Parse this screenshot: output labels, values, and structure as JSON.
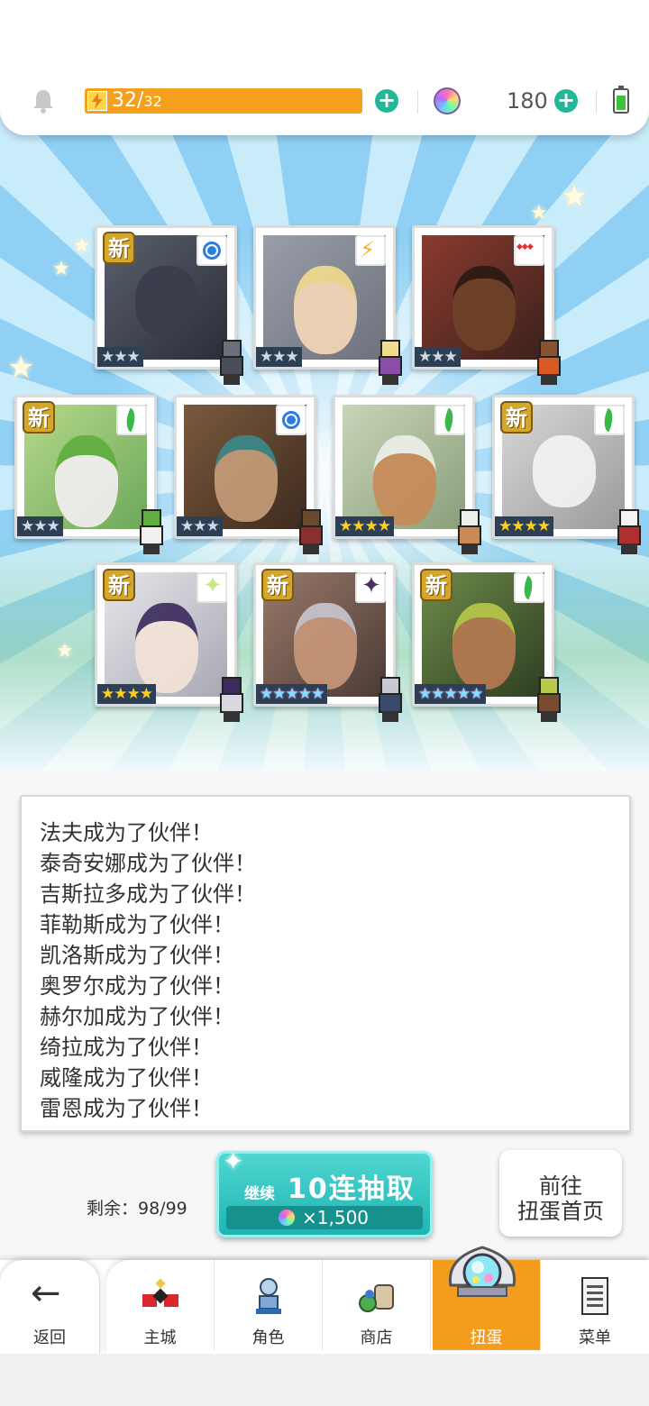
{
  "status_bar": {
    "stamina_current": "32/",
    "stamina_max": "32",
    "gems": "180",
    "colors": {
      "stamina": "#f4a01e",
      "plus": "#21b89a"
    }
  },
  "cards": [
    {
      "new_label": "新",
      "element": "water",
      "rarity": "★★★",
      "rarity_level": 3
    },
    {
      "new_label": "",
      "element": "thunder",
      "rarity": "★★★",
      "rarity_level": 3
    },
    {
      "new_label": "",
      "element": "fire",
      "rarity": "★★★",
      "rarity_level": 3
    },
    {
      "new_label": "新",
      "element": "wind",
      "rarity": "★★★",
      "rarity_level": 3
    },
    {
      "new_label": "",
      "element": "water",
      "rarity": "★★★",
      "rarity_level": 3
    },
    {
      "new_label": "",
      "element": "wind",
      "rarity": "★★★★",
      "rarity_level": 4
    },
    {
      "new_label": "新",
      "element": "wind",
      "rarity": "★★★★",
      "rarity_level": 4
    },
    {
      "new_label": "新",
      "element": "light",
      "rarity": "★★★★",
      "rarity_level": 4
    },
    {
      "new_label": "新",
      "element": "dark",
      "rarity": "★★★★★",
      "rarity_level": 5
    },
    {
      "new_label": "新",
      "element": "wind",
      "rarity": "★★★★★",
      "rarity_level": 5
    }
  ],
  "log": {
    "lines": [
      "法夫成为了伙伴！",
      "泰奇安娜成为了伙伴！",
      "吉斯拉多成为了伙伴！",
      "菲勒斯成为了伙伴！",
      "凯洛斯成为了伙伴！",
      "奥罗尔成为了伙伴！",
      "赫尔加成为了伙伴！",
      "绮拉成为了伙伴！",
      "威隆成为了伙伴！",
      "雷恩成为了伙伴！"
    ]
  },
  "draw": {
    "remaining_label": "剩余：98/99",
    "continue_label": "继续",
    "title": "10连抽取",
    "cost": "×1,500"
  },
  "gacha_home": {
    "line1": "前往",
    "line2": "扭蛋首页"
  },
  "nav": {
    "back": "返回",
    "tabs": [
      {
        "label": "主城",
        "icon": "castle-icon"
      },
      {
        "label": "角色",
        "icon": "character-icon"
      },
      {
        "label": "商店",
        "icon": "shop-icon"
      },
      {
        "label": "扭蛋",
        "icon": "gacha-icon",
        "active": true
      },
      {
        "label": "菜单",
        "icon": "menu-icon"
      }
    ]
  }
}
